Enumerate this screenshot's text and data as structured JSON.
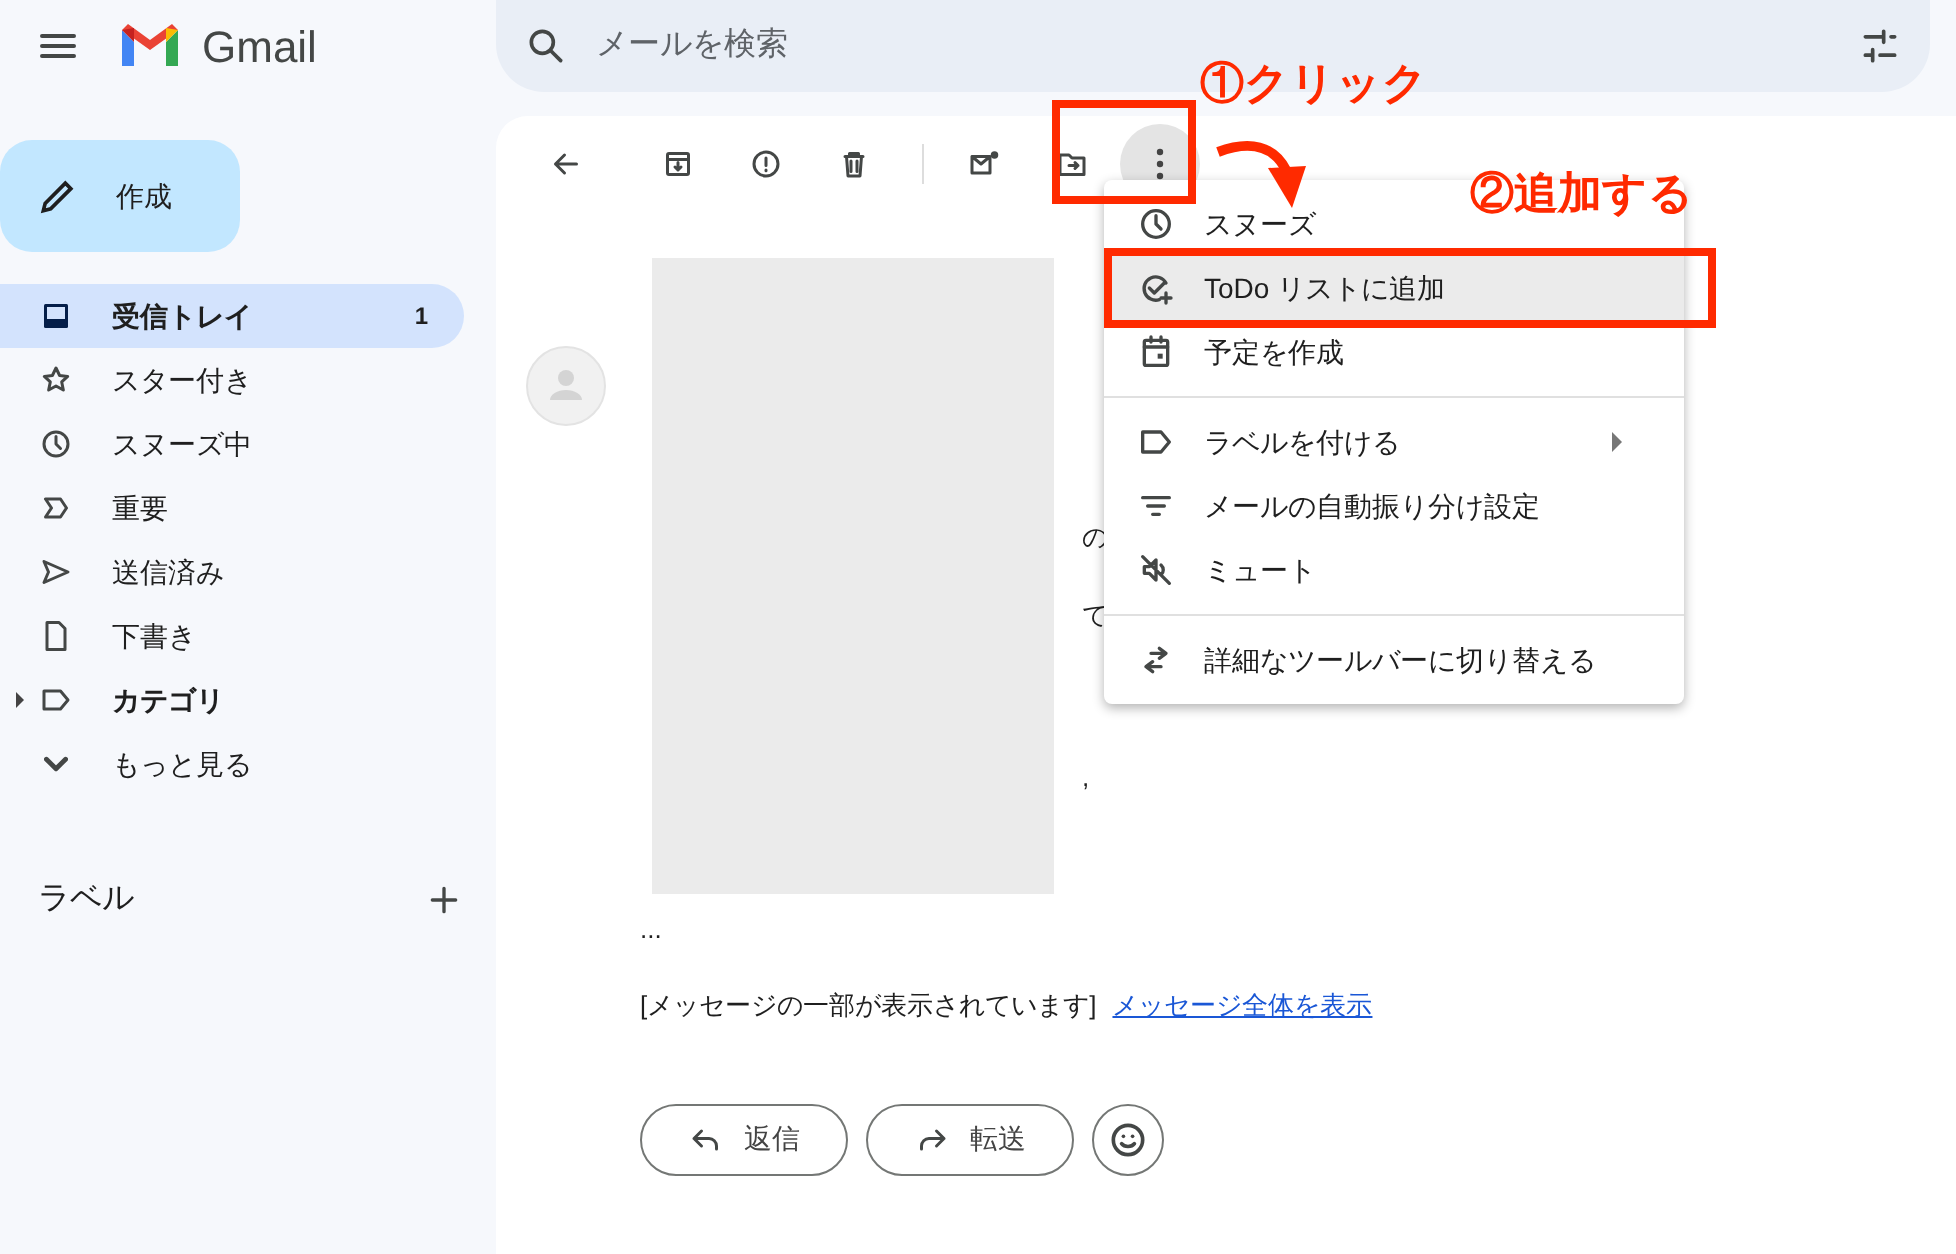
{
  "header": {
    "app_name": "Gmail",
    "search_placeholder": "メールを検索"
  },
  "compose": {
    "label": "作成"
  },
  "nav": [
    {
      "kind": "inbox",
      "label": "受信トレイ",
      "count": "1",
      "selected": true,
      "bold": true
    },
    {
      "kind": "star",
      "label": "スター付き",
      "selected": false,
      "bold": false
    },
    {
      "kind": "clock",
      "label": "スヌーズ中",
      "selected": false,
      "bold": false
    },
    {
      "kind": "important",
      "label": "重要",
      "selected": false,
      "bold": false
    },
    {
      "kind": "send",
      "label": "送信済み",
      "selected": false,
      "bold": false
    },
    {
      "kind": "draft",
      "label": "下書き",
      "selected": false,
      "bold": false
    },
    {
      "kind": "label",
      "label": "カテゴリ",
      "selected": false,
      "bold": true,
      "expandable": true
    },
    {
      "kind": "chevron",
      "label": "もっと見る",
      "selected": false,
      "bold": false
    }
  ],
  "labels_section": {
    "title": "ラベル"
  },
  "menu": {
    "groups": [
      [
        {
          "kind": "clock",
          "label": "スヌーズ",
          "selected": false
        },
        {
          "kind": "task",
          "label": "ToDo リストに追加",
          "selected": true
        },
        {
          "kind": "calendar",
          "label": "予定を作成",
          "selected": false
        }
      ],
      [
        {
          "kind": "label",
          "label": "ラベルを付ける",
          "selected": false,
          "has_submenu": true
        },
        {
          "kind": "filter",
          "label": "メールの自動振り分け設定",
          "selected": false
        },
        {
          "kind": "mute",
          "label": "ミュート",
          "selected": false
        }
      ],
      [
        {
          "kind": "swap",
          "label": "詳細なツールバーに切り替える",
          "selected": false
        }
      ]
    ]
  },
  "message": {
    "fragments": [
      "の",
      "て",
      ","
    ],
    "ellipsis": "...",
    "notice": "[メッセージの一部が表示されています]",
    "link": "メッセージ全体を表示",
    "buttons": [
      {
        "kind": "reply",
        "label": "返信"
      },
      {
        "kind": "forward",
        "label": "転送"
      }
    ]
  },
  "annotations": [
    {
      "label": "①クリック"
    },
    {
      "label": "②追加する"
    }
  ]
}
